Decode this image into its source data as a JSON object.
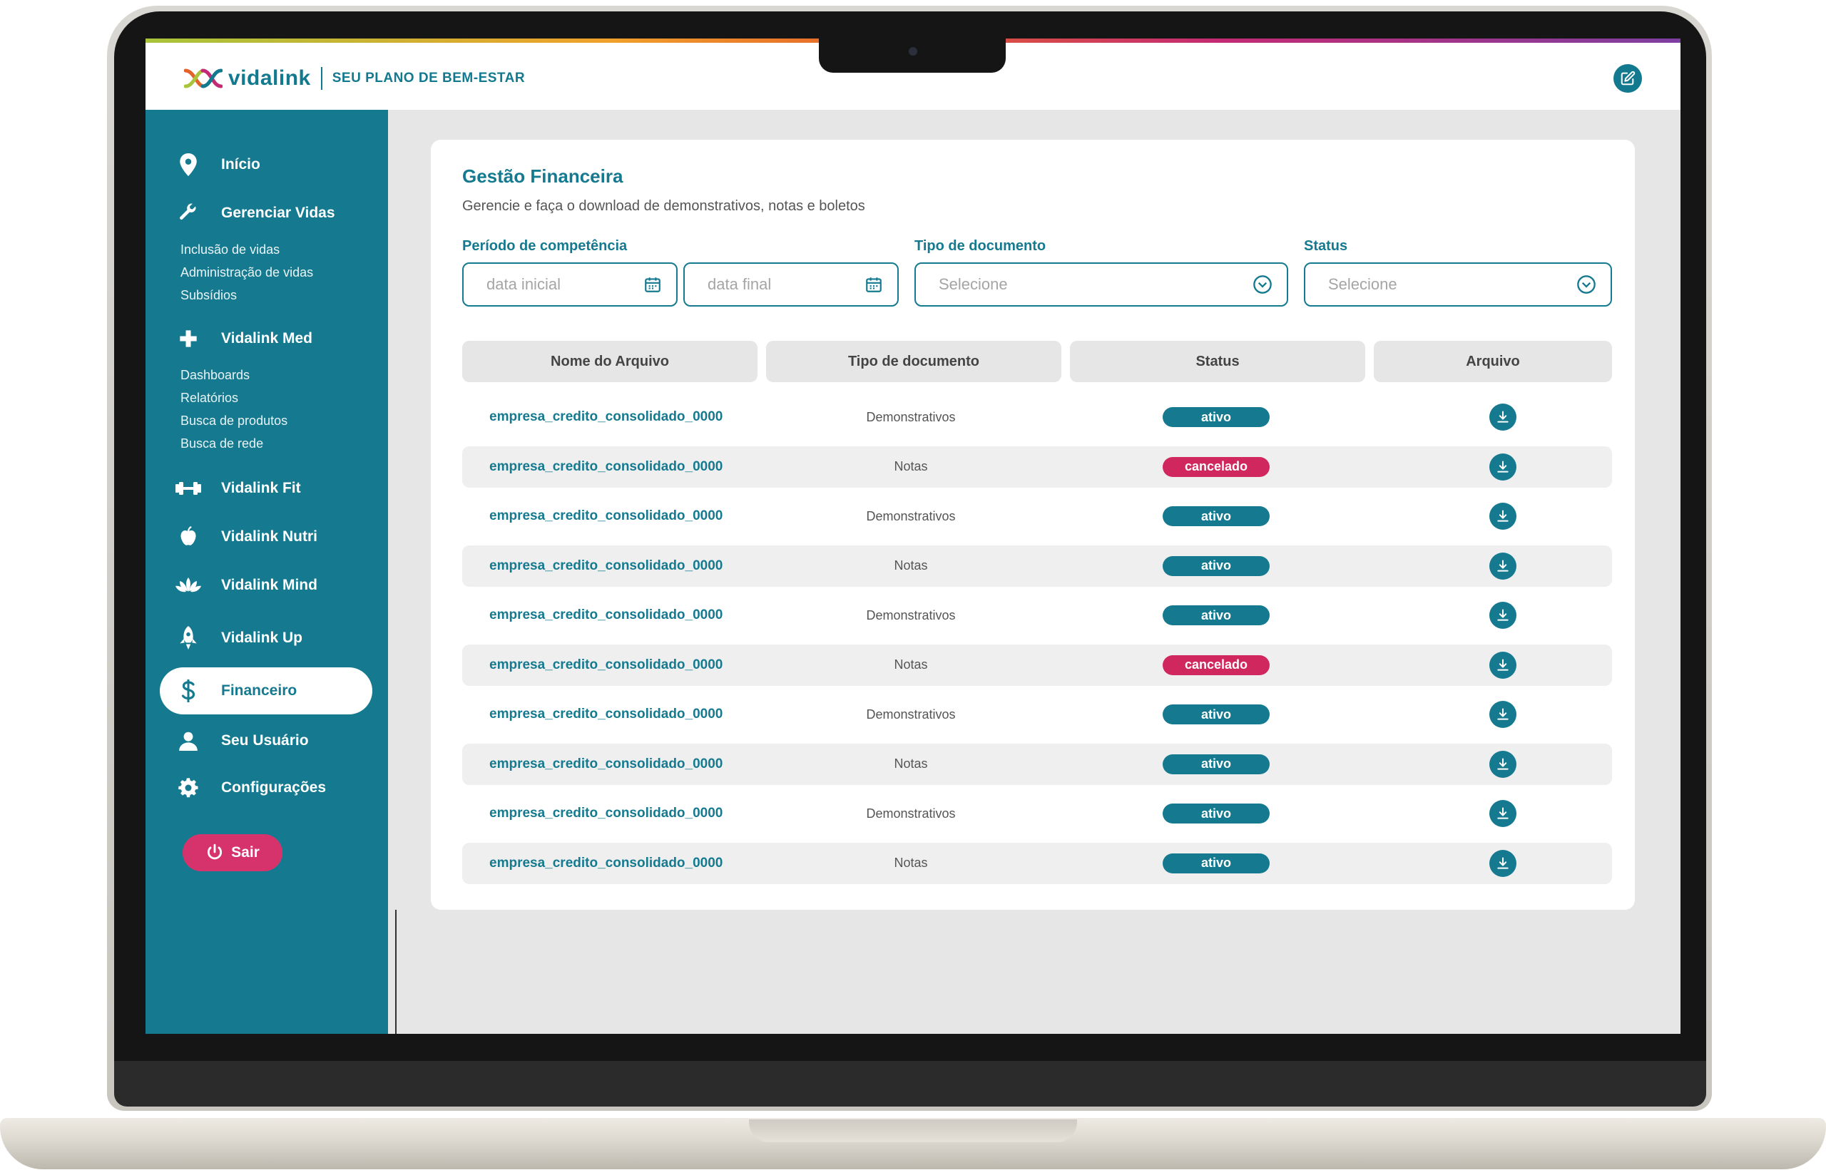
{
  "brand": {
    "name": "vidalink",
    "tagline": "SEU PLANO DE BEM-ESTAR"
  },
  "colors": {
    "primary": "#157a90",
    "danger": "#d1275f",
    "logout": "#d6336c"
  },
  "sidebar": {
    "items": [
      {
        "label": "Início",
        "icon": "map-pin-icon"
      },
      {
        "label": "Gerenciar Vidas",
        "icon": "wrench-icon",
        "sub": [
          "Inclusão de vidas",
          "Administração de vidas",
          "Subsídios"
        ]
      },
      {
        "label": "Vidalink Med",
        "icon": "plus-icon",
        "sub": [
          "Dashboards",
          "Relatórios",
          "Busca de produtos",
          "Busca de rede"
        ]
      },
      {
        "label": "Vidalink Fit",
        "icon": "dumbbell-icon"
      },
      {
        "label": "Vidalink Nutri",
        "icon": "apple-icon"
      },
      {
        "label": "Vidalink Mind",
        "icon": "lotus-icon"
      },
      {
        "label": "Vidalink Up",
        "icon": "rocket-icon"
      },
      {
        "label": "Financeiro",
        "icon": "dollar-icon",
        "active": true
      },
      {
        "label": "Seu Usuário",
        "icon": "user-icon"
      },
      {
        "label": "Configurações",
        "icon": "gear-icon"
      }
    ],
    "logout": "Sair"
  },
  "page": {
    "title": "Gestão Financeira",
    "subtitle": "Gerencie e faça o download de demonstrativos, notas e boletos"
  },
  "filters": {
    "period_label": "Período de competência",
    "start_placeholder": "data inicial",
    "end_placeholder": "data final",
    "doc_type_label": "Tipo de documento",
    "doc_type_value": "Selecione",
    "status_label": "Status",
    "status_value": "Selecione"
  },
  "table": {
    "headers": [
      "Nome do Arquivo",
      "Tipo de documento",
      "Status",
      "Arquivo"
    ],
    "rows": [
      {
        "name": "empresa_credito_consolidado_0000",
        "type": "Demonstrativos",
        "status": "ativo"
      },
      {
        "name": "empresa_credito_consolidado_0000",
        "type": "Notas",
        "status": "cancelado"
      },
      {
        "name": "empresa_credito_consolidado_0000",
        "type": "Demonstrativos",
        "status": "ativo"
      },
      {
        "name": "empresa_credito_consolidado_0000",
        "type": "Notas",
        "status": "ativo"
      },
      {
        "name": "empresa_credito_consolidado_0000",
        "type": "Demonstrativos",
        "status": "ativo"
      },
      {
        "name": "empresa_credito_consolidado_0000",
        "type": "Notas",
        "status": "cancelado"
      },
      {
        "name": "empresa_credito_consolidado_0000",
        "type": "Demonstrativos",
        "status": "ativo"
      },
      {
        "name": "empresa_credito_consolidado_0000",
        "type": "Notas",
        "status": "ativo"
      },
      {
        "name": "empresa_credito_consolidado_0000",
        "type": "Demonstrativos",
        "status": "ativo"
      },
      {
        "name": "empresa_credito_consolidado_0000",
        "type": "Notas",
        "status": "ativo"
      }
    ]
  }
}
